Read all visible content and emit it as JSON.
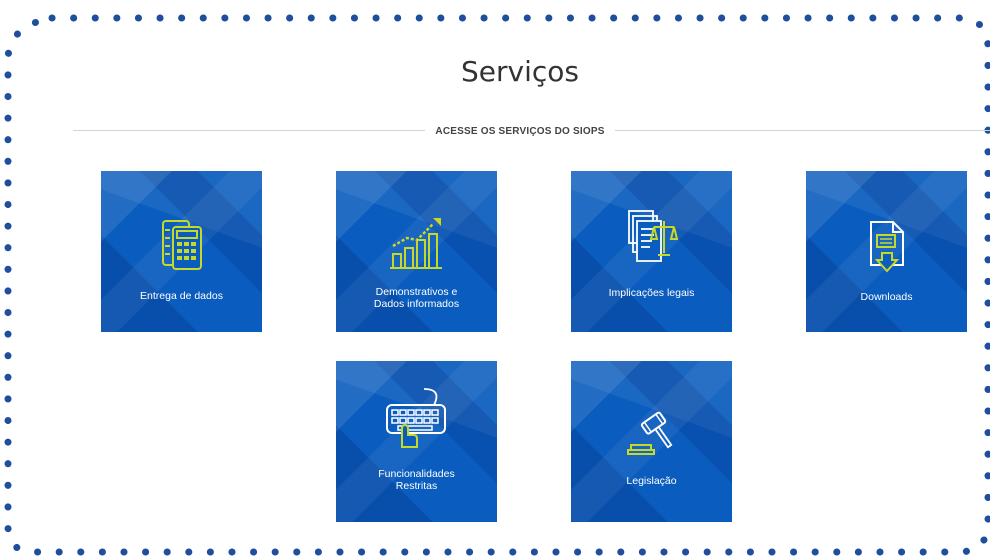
{
  "page": {
    "title": "Serviços",
    "section_heading": "ACESSE OS SERVIÇOS DO SIOPS"
  },
  "tiles": [
    {
      "label_line1": "Entrega de dados",
      "label_line2": "",
      "icon": "calculator-icon"
    },
    {
      "label_line1": "Demonstrativos e",
      "label_line2": "Dados informados",
      "icon": "bar-chart-icon"
    },
    {
      "label_line1": "Implicações legais",
      "label_line2": "",
      "icon": "legal-scale-documents-icon"
    },
    {
      "label_line1": "Downloads",
      "label_line2": "",
      "icon": "download-document-icon"
    },
    {
      "label_line1": "Funcionalidades",
      "label_line2": "Restritas",
      "icon": "keyboard-icon"
    },
    {
      "label_line1": "Legislação",
      "label_line2": "",
      "icon": "gavel-icon"
    }
  ],
  "colors": {
    "tile_blue": "#0a5cbe",
    "icon_yellow": "#c7d928",
    "frame_dots": "#1f4e9e"
  }
}
